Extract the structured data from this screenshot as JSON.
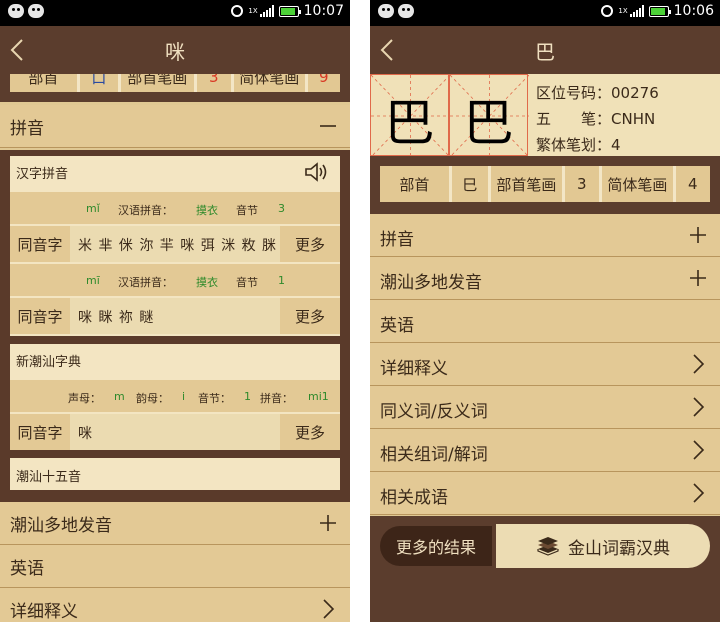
{
  "left": {
    "status": {
      "time": "10:07",
      "signal_tag": "1X"
    },
    "title": "咪",
    "partial_row": {
      "radical_label": "部首",
      "radical": "口",
      "strokes_label": "部首笔画",
      "strokes": "3",
      "simp_label": "简体笔画",
      "simp": "9"
    },
    "pinyin_section": {
      "label": "拼音",
      "action": "collapse"
    },
    "hanzi_card": {
      "title": "汉字拼音",
      "rows": [
        {
          "pinyin": "mǐ",
          "hanyu_label": "汉语拼音：",
          "hanyu": "摸衣",
          "syllable_label": "音节",
          "syllable": "3",
          "homophone_label": "同音字",
          "homophones": "米 芈 侎 沵 羋 咪 弭 洣 敉 脒",
          "more": "更多"
        },
        {
          "pinyin": "mī",
          "hanyu_label": "汉语拼音：",
          "hanyu": "摸衣",
          "syllable_label": "音节",
          "syllable": "1",
          "homophone_label": "同音字",
          "homophones": "咪 眯 祢 瞇",
          "more": "更多"
        }
      ]
    },
    "chaoshan_card": {
      "title": "新潮汕字典",
      "initial_label": "声母：",
      "initial": "m",
      "final_label": "韵母：",
      "final": "i",
      "syllable_label": "音节：",
      "syllable": "1",
      "pinyin_label": "拼音：",
      "pinyin": "mi1",
      "homophone_label": "同音字",
      "homophones": "咪",
      "more": "更多"
    },
    "fifteen_card": {
      "title": "潮汕十五音"
    },
    "sections": [
      {
        "label": "潮汕多地发音",
        "action": "expand"
      },
      {
        "label": "英语",
        "action": ""
      },
      {
        "label": "详细释义",
        "action": "go"
      }
    ]
  },
  "right": {
    "status": {
      "time": "10:06",
      "signal_tag": "1X"
    },
    "title": "巴",
    "big_chars": [
      "巴",
      "巴"
    ],
    "info": {
      "code_label": "区位号码：",
      "code": "00276",
      "wubi_label": "五　　笔：",
      "wubi": "CNHN",
      "trad_label": "繁体笔划：",
      "trad": "4"
    },
    "radicals": {
      "radical_label": "部首",
      "radical": "巳",
      "strokes_label": "部首笔画",
      "strokes": "3",
      "simp_label": "简体笔画",
      "simp": "4"
    },
    "list": [
      {
        "label": "拼音",
        "action": "expand"
      },
      {
        "label": "潮汕多地发音",
        "action": "expand"
      },
      {
        "label": "英语",
        "action": ""
      },
      {
        "label": "详细释义",
        "action": "go"
      },
      {
        "label": "同义词/反义词",
        "action": "go"
      },
      {
        "label": "相关组词/解词",
        "action": "go"
      },
      {
        "label": "相关成语",
        "action": "go"
      }
    ],
    "more_results": "更多的结果",
    "jinshan": "金山词霸汉典"
  }
}
